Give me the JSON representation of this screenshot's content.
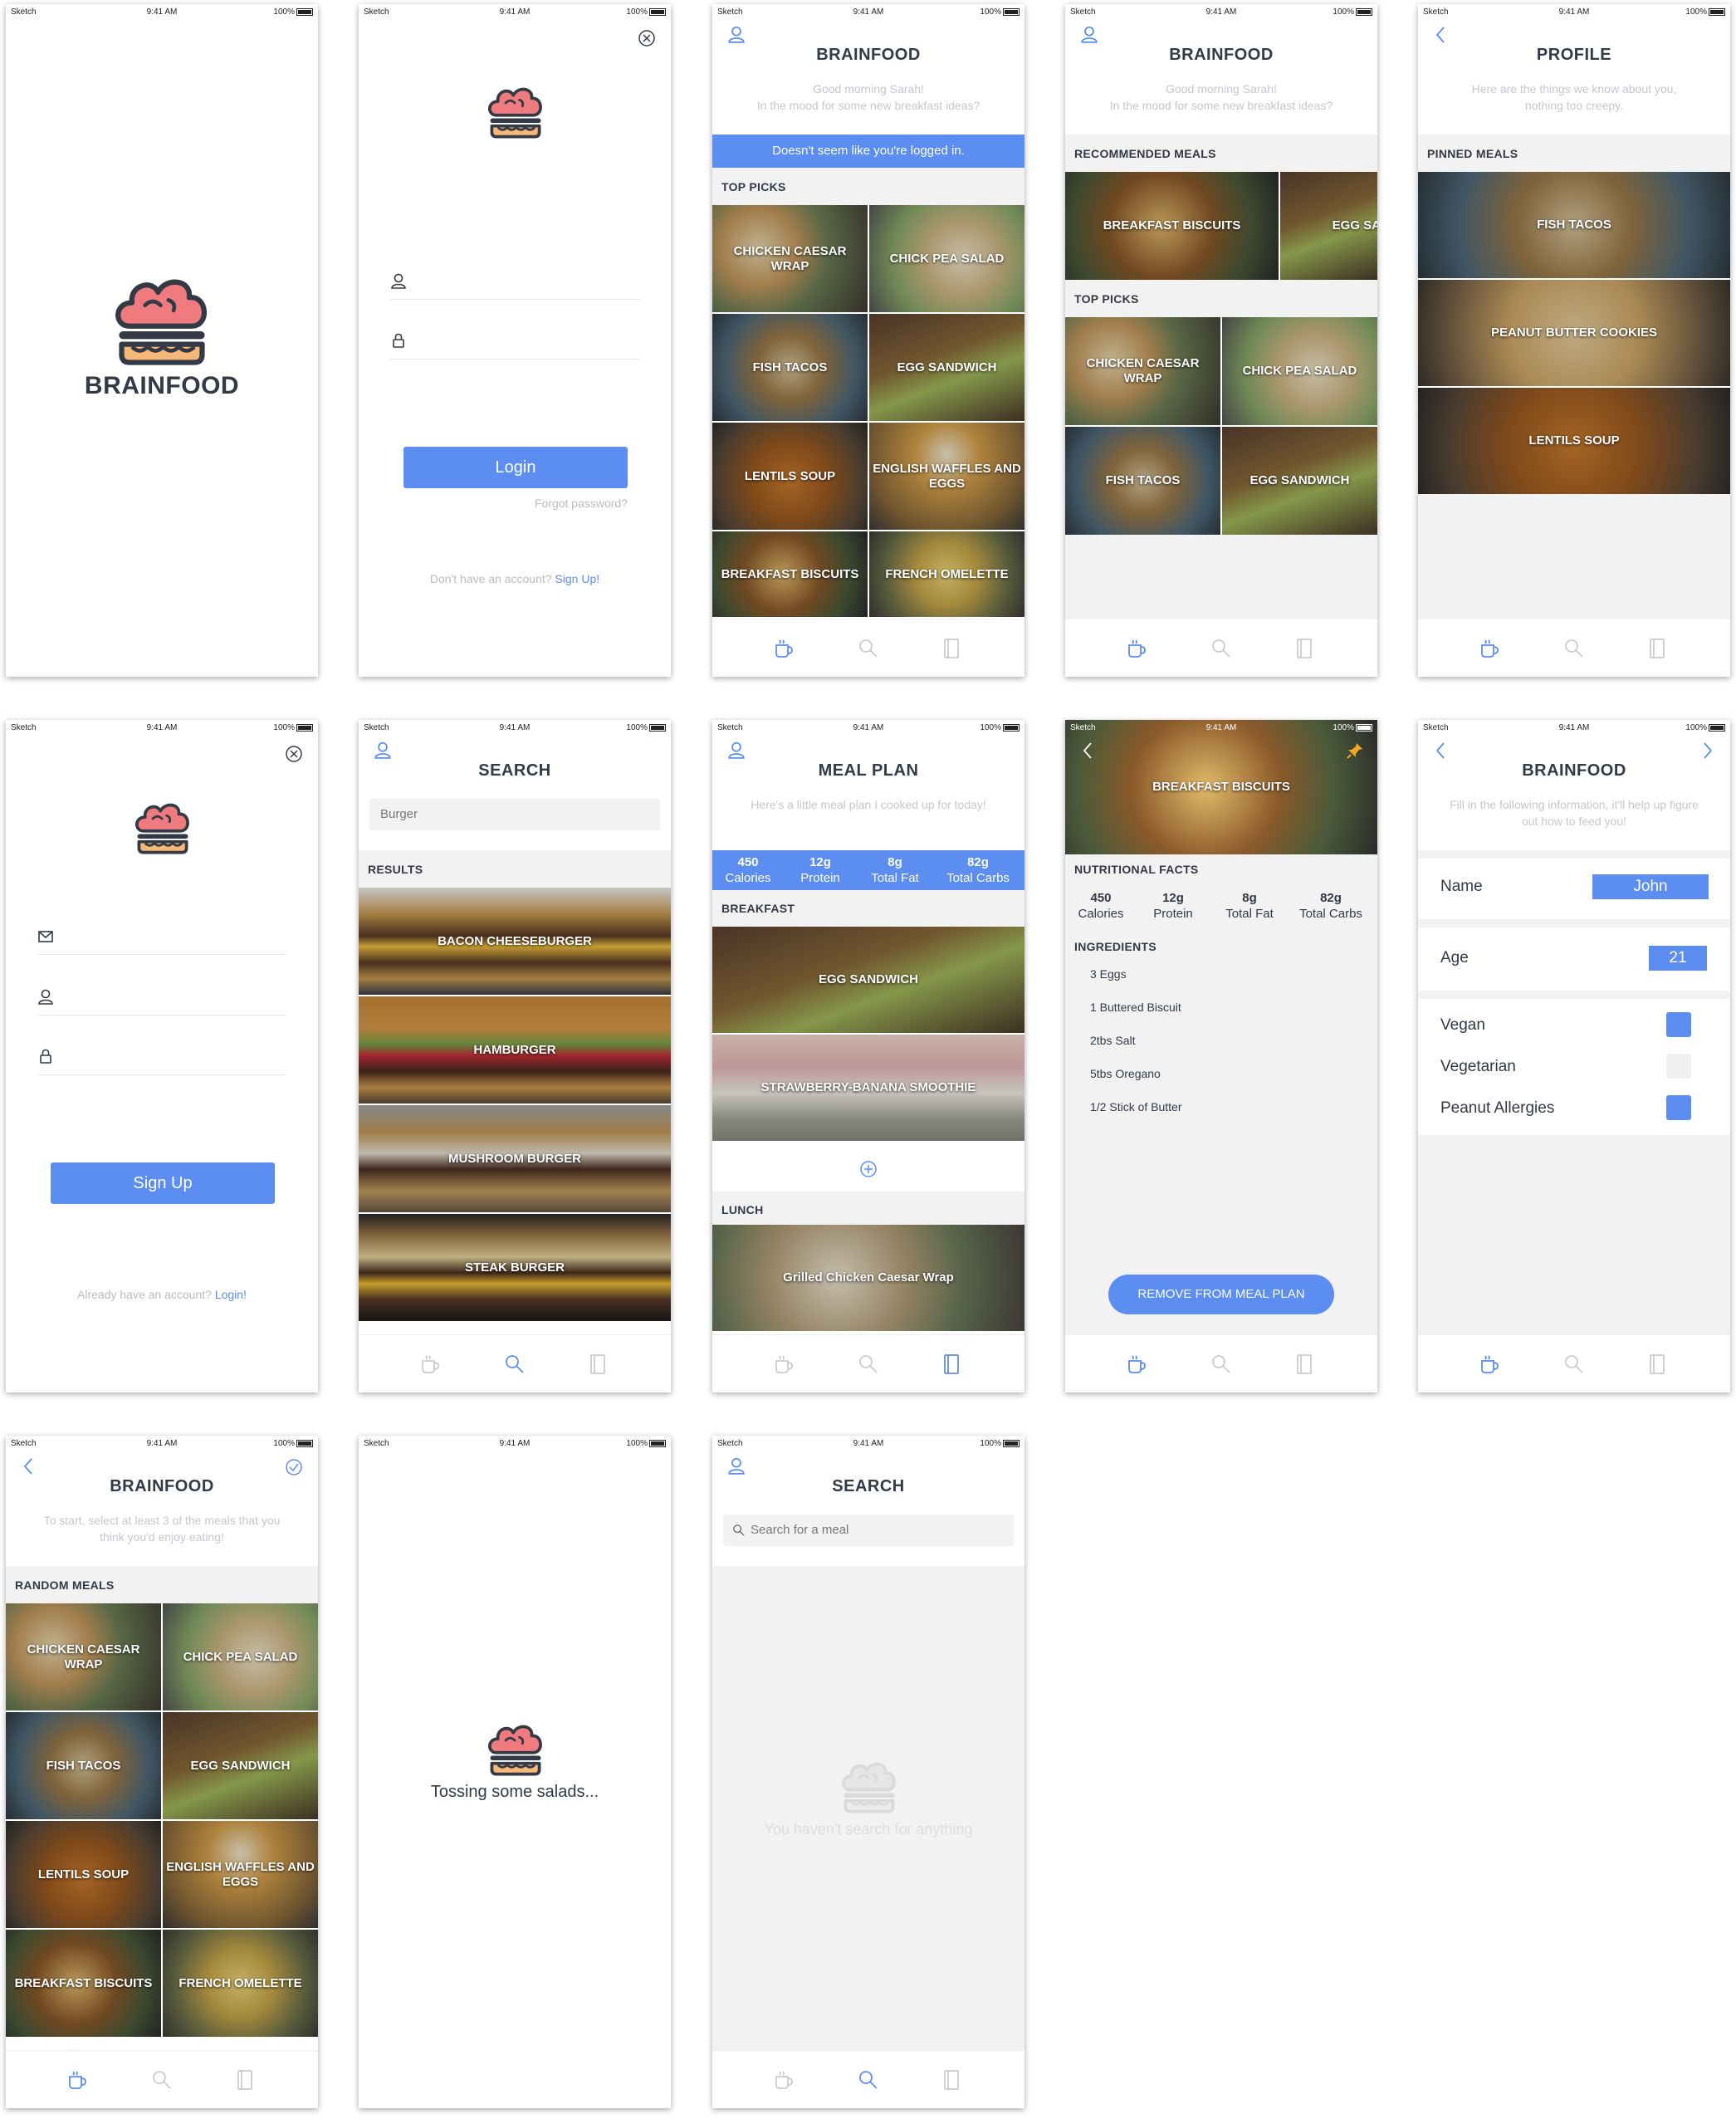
{
  "app_name": "BRAINFOOD",
  "status": {
    "carrier": "Sketch",
    "time": "9:41 AM",
    "battery": "100%"
  },
  "splash": {
    "logo_text": "BRAINFOOD"
  },
  "login": {
    "login_button": "Login",
    "forgot": "Forgot password?",
    "no_account": "Don't have an account?",
    "signup_link": "Sign Up!"
  },
  "home_logged_out": {
    "title": "BRAINFOOD",
    "greeting": "Good morning Sarah!",
    "greeting_sub": "In the mood for some new breakfast ideas?",
    "banner": "Doesn't seem like you're logged in.",
    "section": "TOP PICKS",
    "tiles": [
      "CHICKEN CAESAR WRAP",
      "CHICK PEA SALAD",
      "FISH TACOS",
      "EGG SANDWICH",
      "LENTILS SOUP",
      "ENGLISH WAFFLES AND EGGS",
      "BREAKFAST BISCUITS",
      "FRENCH OMELETTE"
    ]
  },
  "home_logged_in": {
    "title": "BRAINFOOD",
    "greeting": "Good morning Sarah!",
    "greeting_sub": "In the mood for some new breakfast ideas?",
    "section_recommended": "RECOMMENDED MEALS",
    "recommended": [
      "BREAKFAST BISCUITS",
      "EGG SA"
    ],
    "section_top": "TOP PICKS",
    "tiles": [
      "CHICKEN CAESAR WRAP",
      "CHICK PEA SALAD",
      "FISH TACOS",
      "EGG SANDWICH"
    ]
  },
  "profile": {
    "title": "PROFILE",
    "sub": "Here are the things we know about you, nothing too creepy.",
    "section": "PINNED MEALS",
    "pinned": [
      "FISH TACOS",
      "PEANUT BUTTER COOKIES",
      "LENTILS SOUP"
    ]
  },
  "signup": {
    "button": "Sign Up",
    "have_account": "Already have an account?",
    "login_link": "Login!"
  },
  "search_results": {
    "title": "SEARCH",
    "query": "Burger",
    "section": "RESULTS",
    "results": [
      "BACON CHEESEBURGER",
      "HAMBURGER",
      "MUSHROOM BURGER",
      "STEAK BURGER"
    ]
  },
  "meal_plan": {
    "title": "MEAL PLAN",
    "sub": "Here's a little meal plan I cooked up for today!",
    "stats": [
      {
        "value": "450",
        "label": "Calories"
      },
      {
        "value": "12g",
        "label": "Protein"
      },
      {
        "value": "8g",
        "label": "Total Fat"
      },
      {
        "value": "82g",
        "label": "Total Carbs"
      }
    ],
    "section_breakfast": "BREAKFAST",
    "breakfast": [
      "EGG SANDWICH",
      "STRAWBERRY-BANANA SMOOTHIE"
    ],
    "section_lunch": "LUNCH",
    "lunch": [
      "Grilled Chicken Caesar Wrap"
    ]
  },
  "meal_detail": {
    "title": "BREAKFAST BISCUITS",
    "nutrition_heading": "NUTRITIONAL FACTS",
    "stats": [
      {
        "value": "450",
        "label": "Calories"
      },
      {
        "value": "12g",
        "label": "Protein"
      },
      {
        "value": "8g",
        "label": "Total Fat"
      },
      {
        "value": "82g",
        "label": "Total Carbs"
      }
    ],
    "ingredients_heading": "INGREDIENTS",
    "ingredients": [
      "3 Eggs",
      "1 Buttered Biscuit",
      "2tbs Salt",
      "5tbs Oregano",
      "1/2 Stick of Butter"
    ],
    "remove_button": "REMOVE FROM MEAL PLAN"
  },
  "onboarding_info": {
    "title": "BRAINFOOD",
    "sub": "Fill in the following information, it'll help up figure out how to feed you!",
    "name_label": "Name",
    "name_value": "John",
    "age_label": "Age",
    "age_value": "21",
    "vegan_label": "Vegan",
    "vegetarian_label": "Vegetarian",
    "peanut_label": "Peanut Allergies",
    "vegan_checked": true,
    "vegetarian_checked": false,
    "peanut_checked": true
  },
  "onboarding_pick": {
    "title": "BRAINFOOD",
    "sub": "To start, select at least 3 of the meals that you think you'd enjoy eating!",
    "section": "RANDOM MEALS",
    "tiles": [
      "CHICKEN CAESAR WRAP",
      "CHICK PEA SALAD",
      "FISH TACOS",
      "EGG SANDWICH",
      "LENTILS SOUP",
      "ENGLISH WAFFLES AND EGGS",
      "BREAKFAST BISCUITS",
      "FRENCH OMELETTE"
    ]
  },
  "loading": {
    "text": "Tossing some salads..."
  },
  "search_empty": {
    "title": "SEARCH",
    "placeholder": "Search for a meal",
    "empty": "You haven't search for anything"
  },
  "colors": {
    "accent": "#5b8ef0",
    "brain": "#f07b7f",
    "bun": "#f6b878",
    "dark": "#333a45"
  },
  "icons": [
    "user-icon",
    "close-icon",
    "back-icon",
    "forward-icon",
    "check-icon",
    "pin-icon",
    "lock-icon",
    "mail-icon",
    "coffee-icon",
    "search-icon",
    "notebook-icon",
    "plus-icon",
    "brainfood-logo"
  ]
}
